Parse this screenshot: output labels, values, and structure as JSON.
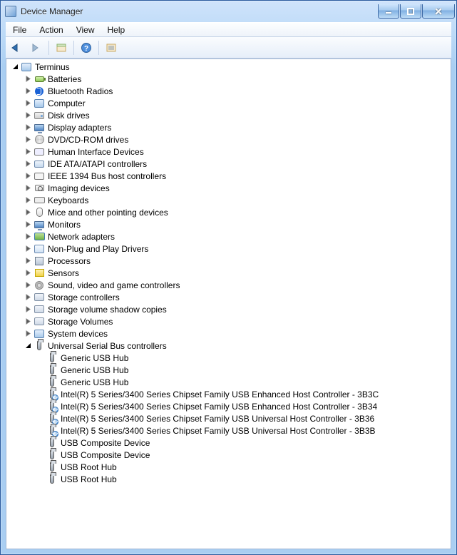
{
  "window": {
    "title": "Device Manager"
  },
  "menubar": [
    "File",
    "Action",
    "View",
    "Help"
  ],
  "toolbar": {
    "back": "back-icon",
    "forward": "forward-icon",
    "show_hidden": "show-hidden-icon",
    "help": "help-icon",
    "properties": "properties-icon"
  },
  "tree": {
    "root": {
      "label": "Terminus",
      "expanded": true
    },
    "categories": [
      {
        "label": "Batteries",
        "icon": "battery"
      },
      {
        "label": "Bluetooth Radios",
        "icon": "bt"
      },
      {
        "label": "Computer",
        "icon": "computer"
      },
      {
        "label": "Disk drives",
        "icon": "disk"
      },
      {
        "label": "Display adapters",
        "icon": "monitor"
      },
      {
        "label": "DVD/CD-ROM drives",
        "icon": "cd"
      },
      {
        "label": "Human Interface Devices",
        "icon": "hid"
      },
      {
        "label": "IDE ATA/ATAPI controllers",
        "icon": "sc"
      },
      {
        "label": "IEEE 1394 Bus host controllers",
        "icon": "ieee"
      },
      {
        "label": "Imaging devices",
        "icon": "cam"
      },
      {
        "label": "Keyboards",
        "icon": "kb"
      },
      {
        "label": "Mice and other pointing devices",
        "icon": "mouse"
      },
      {
        "label": "Monitors",
        "icon": "monitor"
      },
      {
        "label": "Network adapters",
        "icon": "net"
      },
      {
        "label": "Non-Plug and Play Drivers",
        "icon": "box"
      },
      {
        "label": "Processors",
        "icon": "cpu"
      },
      {
        "label": "Sensors",
        "icon": "sensor"
      },
      {
        "label": "Sound, video and game controllers",
        "icon": "speaker"
      },
      {
        "label": "Storage controllers",
        "icon": "storage"
      },
      {
        "label": "Storage volume shadow copies",
        "icon": "storage"
      },
      {
        "label": "Storage Volumes",
        "icon": "storage"
      },
      {
        "label": "System devices",
        "icon": "computer"
      },
      {
        "label": "Universal Serial Bus controllers",
        "icon": "usb",
        "expanded": true
      }
    ],
    "usb_children": [
      {
        "label": "Generic USB Hub",
        "overlay": false
      },
      {
        "label": "Generic USB Hub",
        "overlay": false
      },
      {
        "label": "Generic USB Hub",
        "overlay": false
      },
      {
        "label": "Intel(R) 5 Series/3400 Series Chipset Family USB Enhanced Host Controller - 3B3C",
        "overlay": true
      },
      {
        "label": "Intel(R) 5 Series/3400 Series Chipset Family USB Enhanced Host Controller - 3B34",
        "overlay": true
      },
      {
        "label": "Intel(R) 5 Series/3400 Series Chipset Family USB Universal Host Controller - 3B36",
        "overlay": true
      },
      {
        "label": "Intel(R) 5 Series/3400 Series Chipset Family USB Universal Host Controller - 3B3B",
        "overlay": true
      },
      {
        "label": "USB Composite Device",
        "overlay": false
      },
      {
        "label": "USB Composite Device",
        "overlay": false
      },
      {
        "label": "USB Root Hub",
        "overlay": false
      },
      {
        "label": "USB Root Hub",
        "overlay": false
      }
    ]
  }
}
